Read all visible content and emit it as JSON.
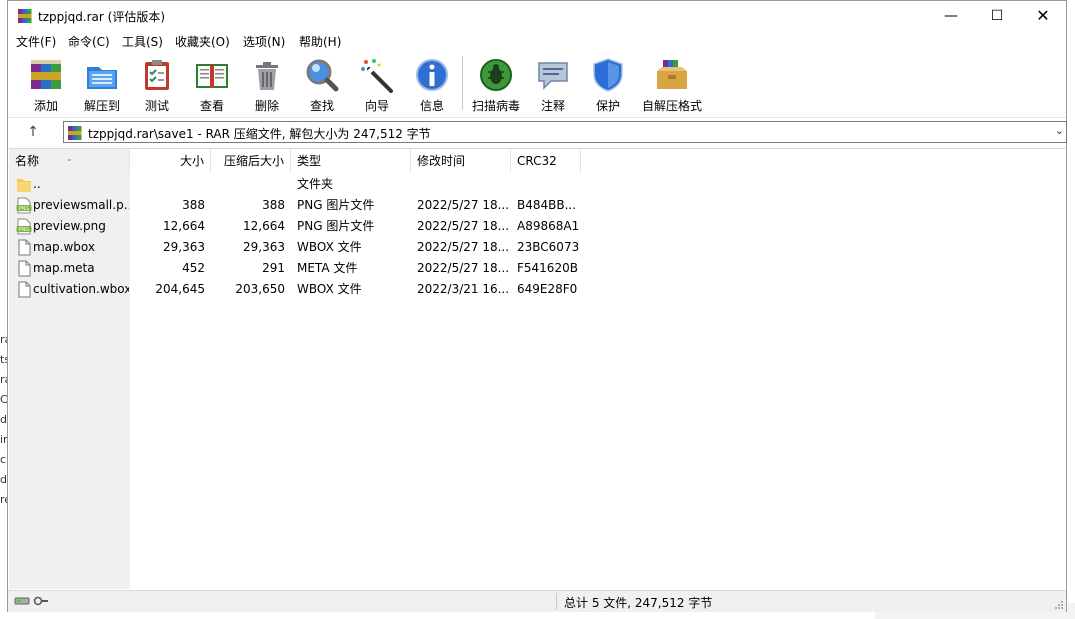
{
  "window": {
    "title": "tzppjqd.rar (评估版本)"
  },
  "menu": [
    "文件(F)",
    "命令(C)",
    "工具(S)",
    "收藏夹(O)",
    "选项(N)",
    "帮助(H)"
  ],
  "toolbar": [
    "添加",
    "解压到",
    "测试",
    "查看",
    "删除",
    "查找",
    "向导",
    "信息",
    "扫描病毒",
    "注释",
    "保护",
    "自解压格式"
  ],
  "address": {
    "path": "tzppjqd.rar\\save1 - RAR 压缩文件, 解包大小为 247,512 字节"
  },
  "columns": [
    "名称",
    "大小",
    "压缩后大小",
    "类型",
    "修改时间",
    "CRC32"
  ],
  "files": [
    {
      "icon": "folder-icon",
      "name": "..",
      "size": "",
      "packed": "",
      "type": "文件夹",
      "modified": "",
      "crc": ""
    },
    {
      "icon": "png-file-icon",
      "name": "previewsmall.p...",
      "size": "388",
      "packed": "388",
      "type": "PNG 图片文件",
      "modified": "2022/5/27 18...",
      "crc": "B484BB..."
    },
    {
      "icon": "png-file-icon",
      "name": "preview.png",
      "size": "12,664",
      "packed": "12,664",
      "type": "PNG 图片文件",
      "modified": "2022/5/27 18...",
      "crc": "A89868A1"
    },
    {
      "icon": "file-icon",
      "name": "map.wbox",
      "size": "29,363",
      "packed": "29,363",
      "type": "WBOX 文件",
      "modified": "2022/5/27 18...",
      "crc": "23BC6073"
    },
    {
      "icon": "file-icon",
      "name": "map.meta",
      "size": "452",
      "packed": "291",
      "type": "META 文件",
      "modified": "2022/5/27 18...",
      "crc": "F541620B"
    },
    {
      "icon": "file-icon",
      "name": "cultivation.wbox",
      "size": "204,645",
      "packed": "203,650",
      "type": "WBOX 文件",
      "modified": "2022/3/21 16...",
      "crc": "649E28F0"
    }
  ],
  "status": {
    "text": "总计 5 文件, 247,512 字节"
  },
  "background_fragments": [
    "ra",
    "ts",
    "ra",
    "Ca",
    "dp",
    "in",
    "cl",
    "d",
    "re"
  ]
}
